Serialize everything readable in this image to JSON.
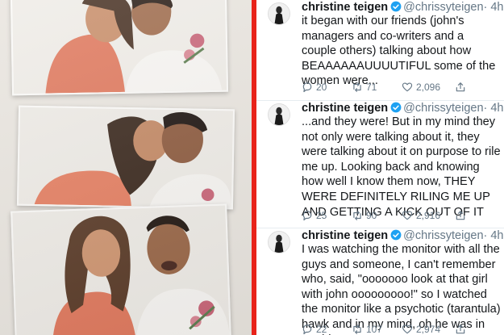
{
  "page": {
    "divider_color": "#e8231a",
    "accent": "#1da1f2"
  },
  "photos": {
    "description_icon": "photo-booth-strip",
    "frames": 3
  },
  "tweets": [
    {
      "name": "christine teigen",
      "handle": "@chrissyteigen",
      "time": "· 4h",
      "text": "it began with our friends (john's managers and co-writers and a couple others) talking about how BEAAAAAAUUUUTIFUL some of the women were...",
      "replies": "20",
      "retweets": "71",
      "likes": "2,096"
    },
    {
      "name": "christine teigen",
      "handle": "@chrissyteigen",
      "time": "· 4h",
      "text": "...and they were! But in my mind they not only were talking about it, they were talking about it on purpose to rile me up. Looking back and knowing how well I know them now, THEY WERE DEFINITELY RILING ME UP AND GETTING A KICK OUT OF IT",
      "replies": "25",
      "retweets": "90",
      "likes": "2,916"
    },
    {
      "name": "christine teigen",
      "handle": "@chrissyteigen",
      "time": "· 4h",
      "text": "I was watching the monitor with all the guys and someone, I can't remember who, said, \"ooooooo look at that girl with john ooooooooo!\" so I watched the monitor like a psychotic (tarantula) hawk and in my mind, oh he was in trouble",
      "replies": "22",
      "retweets": "107",
      "likes": "2,974"
    }
  ]
}
